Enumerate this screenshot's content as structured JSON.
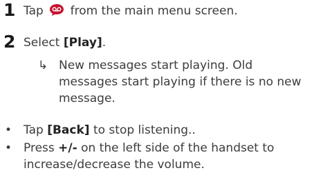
{
  "steps": [
    {
      "number": "1",
      "before": "Tap",
      "after": "from the main menu screen."
    },
    {
      "number": "2",
      "before": "Select",
      "bold": "[Play]",
      "after": "."
    }
  ],
  "result": {
    "arrow": "↳",
    "text": "New messages start playing. Old messages start playing if there is no new message."
  },
  "bullets": [
    {
      "before": "Tap",
      "bold": "[Back]",
      "after": "to stop listening.."
    },
    {
      "before": "Press",
      "bold": "+/-",
      "after": "on the left side of the handset to increase/decrease the volume."
    }
  ],
  "icons": {
    "voicemail": "voicemail-icon",
    "accent": "#c8102e"
  }
}
